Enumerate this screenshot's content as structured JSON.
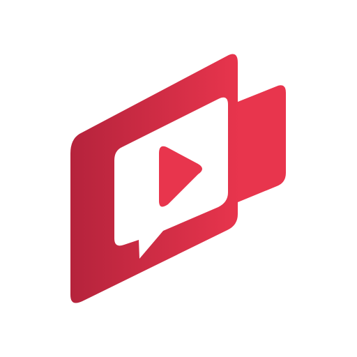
{
  "logo": {
    "icon": "video-chat-play-logo",
    "colors": {
      "primary": "#e8354d",
      "primary_dark": "#b5233c",
      "background": "#ffffff",
      "cutout": "#ffffff"
    }
  }
}
